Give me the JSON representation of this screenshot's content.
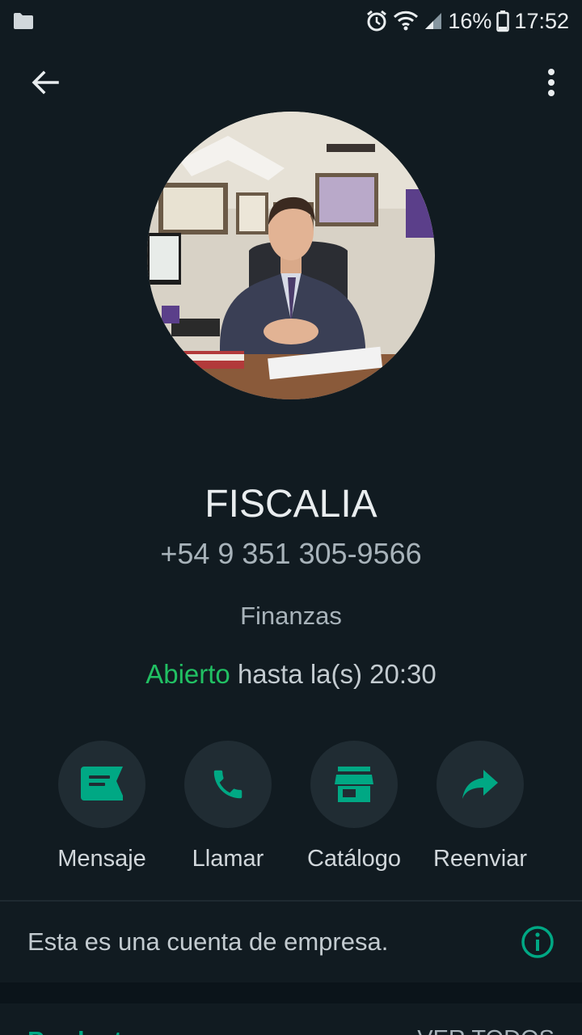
{
  "status_bar": {
    "battery": "16%",
    "time": "17:52"
  },
  "profile": {
    "name": "FISCALIA",
    "phone": "+54 9 351 305-9566",
    "category": "Finanzas",
    "hours_status": "Abierto",
    "hours_text": "hasta la(s) 20:30"
  },
  "actions": [
    {
      "label": "Mensaje",
      "icon": "message-icon"
    },
    {
      "label": "Llamar",
      "icon": "phone-icon"
    },
    {
      "label": "Catálogo",
      "icon": "store-icon"
    },
    {
      "label": "Reenviar",
      "icon": "forward-icon"
    }
  ],
  "business_note": "Esta es una cuenta de empresa.",
  "products": {
    "title": "Productos",
    "see_all": "VER TODOS"
  },
  "colors": {
    "background": "#111b21",
    "accent": "#00a884",
    "open_green": "#21c063",
    "button_bg": "#202c33"
  }
}
